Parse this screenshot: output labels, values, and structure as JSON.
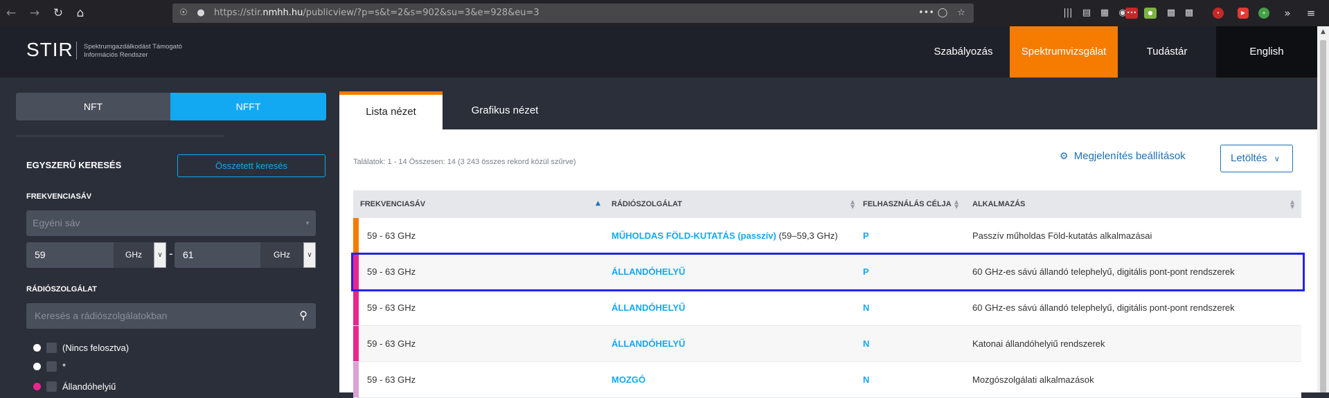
{
  "browser": {
    "url_prefix": "https://stir.",
    "url_host": "nmhh.hu",
    "url_path": "/publicview/?p=s&t=2&s=902&su=3&e=928&eu=3",
    "url_dots": "•••"
  },
  "header": {
    "logo": "STIR",
    "subtitle_line1": "Spektrumgazdálkodást Támogató",
    "subtitle_line2": "Információs Rendszer",
    "nav": [
      {
        "label": "Szabályozás"
      },
      {
        "label": "Spektrumvizsgálat"
      },
      {
        "label": "Tudástár"
      },
      {
        "label": "English"
      }
    ]
  },
  "left": {
    "toggle_nft": "NFT",
    "toggle_nfft": "NFFT",
    "simple_search": "EGYSZERŰ KERESÉS",
    "advanced_search": "Összetett keresés",
    "freq_label": "FREKVENCIASÁV",
    "band_select": "Egyéni sáv",
    "freq_from": "59",
    "freq_to": "61",
    "unit": "GHz",
    "radio_label": "RÁDIÓSZOLGÁLAT",
    "radio_search_placeholder": "Keresés a rádiószolgálatokban",
    "legend": [
      {
        "text": "(Nincs felosztva)",
        "color": "#ffffff"
      },
      {
        "text": "*",
        "color": "#ffffff"
      },
      {
        "text": "Állandóhelyiű",
        "color": "#e8278c"
      }
    ]
  },
  "main": {
    "tabs": [
      {
        "label": "Lista nézet"
      },
      {
        "label": "Grafikus nézet"
      }
    ],
    "result_count": "Találatok: 1 - 14 Összesen: 14 (3 243 összes rekord közül szűrve)",
    "display_settings": "Megjelenítés beállítások",
    "download": "Letöltés",
    "columns": [
      "FREKVENCIASÁV",
      "RÁDIÓSZOLGÁLAT",
      "FELHASZNÁLÁS CÉLJA",
      "ALKALMAZÁS"
    ],
    "rows": [
      {
        "band": "59 - 63 GHz",
        "service": "MŰHOLDAS FÖLD-KUTATÁS (passzív)",
        "service_extra": " (59–59,3 GHz)",
        "use": "P",
        "app": "Passzív műholdas Föld-kutatás alkalmazásai",
        "color": "#f57c00"
      },
      {
        "band": "59 - 63 GHz",
        "service": "ÁLLANDÓHELYŰ",
        "service_extra": "",
        "use": "P",
        "app": "60 GHz-es sávú állandó telephelyű, digitális pont-pont rendszerek",
        "color": "#e8278c"
      },
      {
        "band": "59 - 63 GHz",
        "service": "ÁLLANDÓHELYŰ",
        "service_extra": "",
        "use": "N",
        "app": "60 GHz-es sávú állandó telephelyű, digitális pont-pont rendszerek",
        "color": "#e8278c"
      },
      {
        "band": "59 - 63 GHz",
        "service": "ÁLLANDÓHELYŰ",
        "service_extra": "",
        "use": "N",
        "app": "Katonai állandóhelyiű rendszerek",
        "color": "#e8278c"
      },
      {
        "band": "59 - 63 GHz",
        "service": "MOZGÓ",
        "service_extra": "",
        "use": "N",
        "app": "Mozgószolgálati alkalmazások",
        "color": "#d9a3d6"
      }
    ]
  }
}
